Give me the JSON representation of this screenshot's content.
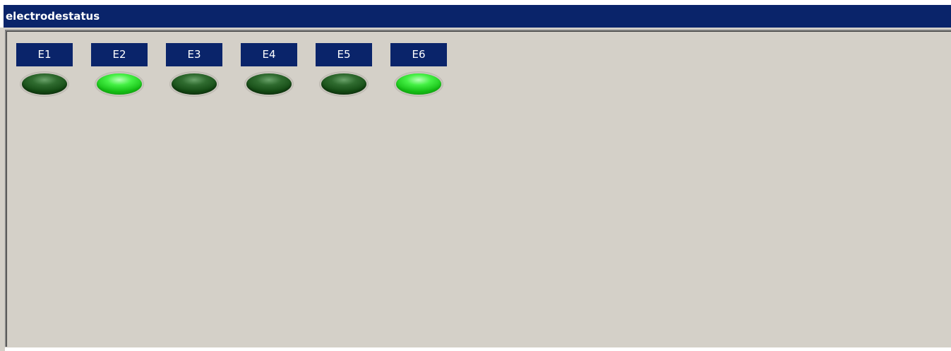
{
  "window": {
    "title": "electrodestatus"
  },
  "electrodes": [
    {
      "label": "E1",
      "state": "off"
    },
    {
      "label": "E2",
      "state": "on"
    },
    {
      "label": "E3",
      "state": "off"
    },
    {
      "label": "E4",
      "state": "off"
    },
    {
      "label": "E5",
      "state": "off"
    },
    {
      "label": "E6",
      "state": "on"
    }
  ],
  "colors": {
    "titlebar": "#0a246a",
    "panel": "#d4d0c8",
    "led_on": "#44f044",
    "led_off": "#2f6b2f"
  }
}
